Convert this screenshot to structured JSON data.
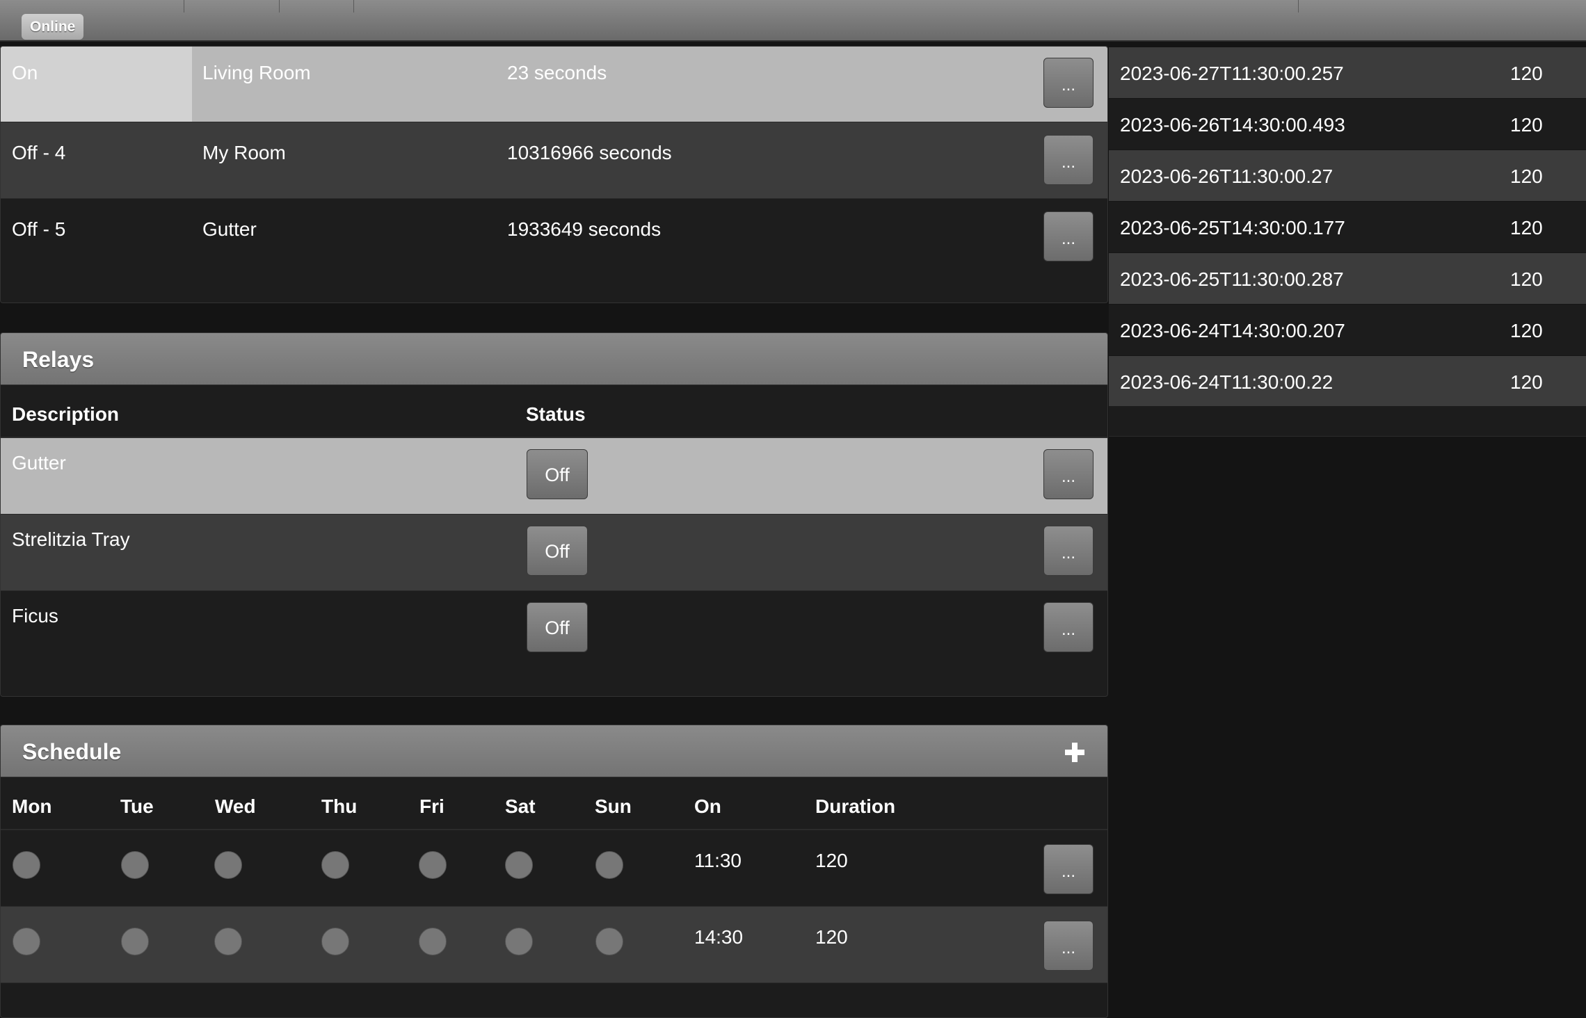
{
  "status_badge": "Online",
  "sensors": {
    "rows": [
      {
        "state": "On",
        "location": "Living Room",
        "age": "23 seconds",
        "more": "..."
      },
      {
        "state": "Off - 4",
        "location": "My Room",
        "age": "10316966 seconds",
        "more": "..."
      },
      {
        "state": "Off - 5",
        "location": "Gutter",
        "age": "1933649 seconds",
        "more": "..."
      }
    ]
  },
  "relays": {
    "title": "Relays",
    "columns": {
      "description": "Description",
      "status": "Status"
    },
    "rows": [
      {
        "description": "Gutter",
        "status": "Off",
        "more": "..."
      },
      {
        "description": "Strelitzia Tray",
        "status": "Off",
        "more": "..."
      },
      {
        "description": "Ficus",
        "status": "Off",
        "more": "..."
      }
    ]
  },
  "schedule": {
    "title": "Schedule",
    "add_icon": "plus-icon",
    "columns": {
      "mon": "Mon",
      "tue": "Tue",
      "wed": "Wed",
      "thu": "Thu",
      "fri": "Fri",
      "sat": "Sat",
      "sun": "Sun",
      "on": "On",
      "duration": "Duration"
    },
    "rows": [
      {
        "on": "11:30",
        "duration": "120",
        "more": "..."
      },
      {
        "on": "14:30",
        "duration": "120",
        "more": "..."
      }
    ]
  },
  "history": {
    "rows": [
      {
        "timestamp": "2023-06-27T11:30:00.257",
        "value": "120"
      },
      {
        "timestamp": "2023-06-26T14:30:00.493",
        "value": "120"
      },
      {
        "timestamp": "2023-06-26T11:30:00.27",
        "value": "120"
      },
      {
        "timestamp": "2023-06-25T14:30:00.177",
        "value": "120"
      },
      {
        "timestamp": "2023-06-25T11:30:00.287",
        "value": "120"
      },
      {
        "timestamp": "2023-06-24T14:30:00.207",
        "value": "120"
      },
      {
        "timestamp": "2023-06-24T11:30:00.22",
        "value": "120"
      }
    ]
  },
  "colors": {
    "accent": "#7a7a7a",
    "selected_row": "#b8b8b8",
    "background": "#141414"
  }
}
